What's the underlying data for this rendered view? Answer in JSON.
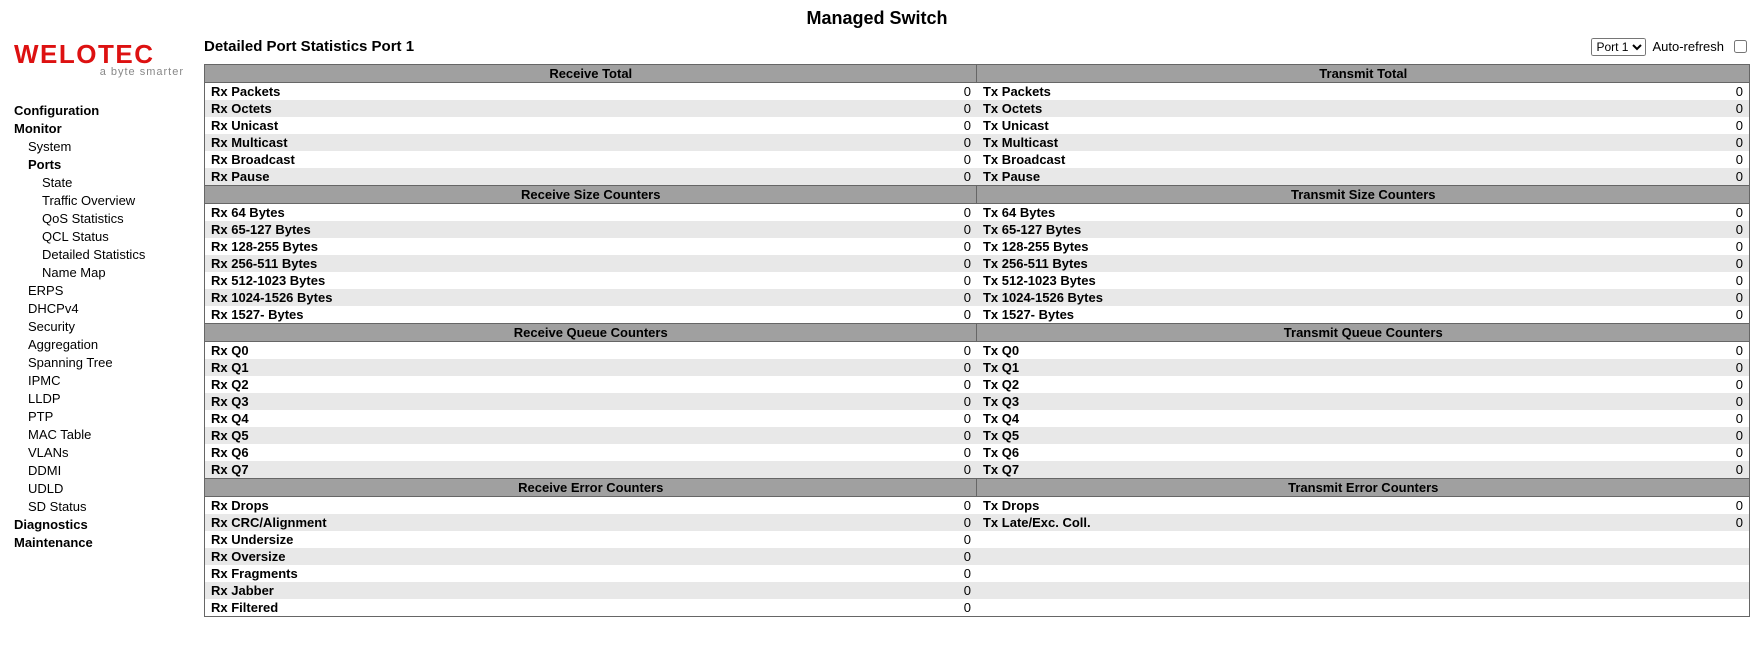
{
  "banner_title": "Managed Switch",
  "logo": {
    "main": "WELOTEC",
    "tag": "a byte smarter"
  },
  "nav": {
    "configuration": "Configuration",
    "monitor": "Monitor",
    "system": "System",
    "ports": "Ports",
    "state": "State",
    "traffic_overview": "Traffic Overview",
    "qos_stats": "QoS Statistics",
    "qcl_status": "QCL Status",
    "detailed_stats": "Detailed Statistics",
    "name_map": "Name Map",
    "erps": "ERPS",
    "dhcpv4": "DHCPv4",
    "security": "Security",
    "aggregation": "Aggregation",
    "spanning_tree": "Spanning Tree",
    "ipmc": "IPMC",
    "lldp": "LLDP",
    "ptp": "PTP",
    "mac_table": "MAC Table",
    "vlans": "VLANs",
    "ddmi": "DDMI",
    "udld": "UDLD",
    "sd_status": "SD Status",
    "diagnostics": "Diagnostics",
    "maintenance": "Maintenance"
  },
  "page_title": "Detailed Port Statistics  Port 1",
  "controls": {
    "port_options": [
      "Port 1"
    ],
    "port_selected": "Port 1",
    "auto_refresh_label": "Auto-refresh"
  },
  "sections": [
    {
      "rx_header": "Receive Total",
      "tx_header": "Transmit Total",
      "rows": [
        {
          "rl": "Rx Packets",
          "rv": "0",
          "tl": "Tx Packets",
          "tv": "0"
        },
        {
          "rl": "Rx Octets",
          "rv": "0",
          "tl": "Tx Octets",
          "tv": "0"
        },
        {
          "rl": "Rx Unicast",
          "rv": "0",
          "tl": "Tx Unicast",
          "tv": "0"
        },
        {
          "rl": "Rx Multicast",
          "rv": "0",
          "tl": "Tx Multicast",
          "tv": "0"
        },
        {
          "rl": "Rx Broadcast",
          "rv": "0",
          "tl": "Tx Broadcast",
          "tv": "0"
        },
        {
          "rl": "Rx Pause",
          "rv": "0",
          "tl": "Tx Pause",
          "tv": "0"
        }
      ]
    },
    {
      "rx_header": "Receive Size Counters",
      "tx_header": "Transmit Size Counters",
      "rows": [
        {
          "rl": "Rx 64 Bytes",
          "rv": "0",
          "tl": "Tx 64 Bytes",
          "tv": "0"
        },
        {
          "rl": "Rx 65-127 Bytes",
          "rv": "0",
          "tl": "Tx 65-127 Bytes",
          "tv": "0"
        },
        {
          "rl": "Rx 128-255 Bytes",
          "rv": "0",
          "tl": "Tx 128-255 Bytes",
          "tv": "0"
        },
        {
          "rl": "Rx 256-511 Bytes",
          "rv": "0",
          "tl": "Tx 256-511 Bytes",
          "tv": "0"
        },
        {
          "rl": "Rx 512-1023 Bytes",
          "rv": "0",
          "tl": "Tx 512-1023 Bytes",
          "tv": "0"
        },
        {
          "rl": "Rx 1024-1526 Bytes",
          "rv": "0",
          "tl": "Tx 1024-1526 Bytes",
          "tv": "0"
        },
        {
          "rl": "Rx 1527- Bytes",
          "rv": "0",
          "tl": "Tx 1527- Bytes",
          "tv": "0"
        }
      ]
    },
    {
      "rx_header": "Receive Queue Counters",
      "tx_header": "Transmit Queue Counters",
      "rows": [
        {
          "rl": "Rx Q0",
          "rv": "0",
          "tl": "Tx Q0",
          "tv": "0"
        },
        {
          "rl": "Rx Q1",
          "rv": "0",
          "tl": "Tx Q1",
          "tv": "0"
        },
        {
          "rl": "Rx Q2",
          "rv": "0",
          "tl": "Tx Q2",
          "tv": "0"
        },
        {
          "rl": "Rx Q3",
          "rv": "0",
          "tl": "Tx Q3",
          "tv": "0"
        },
        {
          "rl": "Rx Q4",
          "rv": "0",
          "tl": "Tx Q4",
          "tv": "0"
        },
        {
          "rl": "Rx Q5",
          "rv": "0",
          "tl": "Tx Q5",
          "tv": "0"
        },
        {
          "rl": "Rx Q6",
          "rv": "0",
          "tl": "Tx Q6",
          "tv": "0"
        },
        {
          "rl": "Rx Q7",
          "rv": "0",
          "tl": "Tx Q7",
          "tv": "0"
        }
      ]
    },
    {
      "rx_header": "Receive Error Counters",
      "tx_header": "Transmit Error Counters",
      "rows": [
        {
          "rl": "Rx Drops",
          "rv": "0",
          "tl": "Tx Drops",
          "tv": "0"
        },
        {
          "rl": "Rx CRC/Alignment",
          "rv": "0",
          "tl": "Tx Late/Exc. Coll.",
          "tv": "0"
        },
        {
          "rl": "Rx Undersize",
          "rv": "0",
          "tl": "",
          "tv": ""
        },
        {
          "rl": "Rx Oversize",
          "rv": "0",
          "tl": "",
          "tv": ""
        },
        {
          "rl": "Rx Fragments",
          "rv": "0",
          "tl": "",
          "tv": ""
        },
        {
          "rl": "Rx Jabber",
          "rv": "0",
          "tl": "",
          "tv": ""
        },
        {
          "rl": "Rx Filtered",
          "rv": "0",
          "tl": "",
          "tv": ""
        }
      ]
    }
  ]
}
